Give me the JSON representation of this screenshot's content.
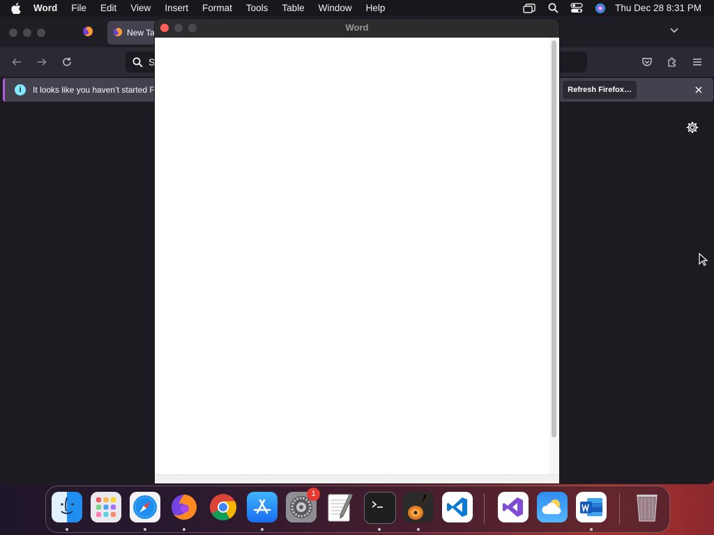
{
  "menubar": {
    "app_name": "Word",
    "menus": [
      "File",
      "Edit",
      "View",
      "Insert",
      "Format",
      "Tools",
      "Table",
      "Window",
      "Help"
    ],
    "clock": "Thu Dec 28  8:31 PM",
    "status_icons": [
      "window-switcher-icon",
      "spotlight-search-icon",
      "control-center-icon",
      "siri-icon"
    ]
  },
  "firefox": {
    "tab_title": "New Ta",
    "url_placeholder": "S",
    "notification": {
      "message": "It looks like you haven’t started Fi",
      "button_label": "Refresh Firefox…"
    }
  },
  "word": {
    "window_title": "Word"
  },
  "dock": {
    "apps": [
      {
        "name": "Finder",
        "icon": "finder-icon",
        "running": true
      },
      {
        "name": "Launchpad",
        "icon": "launchpad-icon",
        "running": false
      },
      {
        "name": "Safari",
        "icon": "safari-icon",
        "running": true
      },
      {
        "name": "Firefox",
        "icon": "firefox-icon",
        "running": true
      },
      {
        "name": "Google Chrome",
        "icon": "chrome-icon",
        "running": false
      },
      {
        "name": "App Store",
        "icon": "app-store-icon",
        "running": true
      },
      {
        "name": "System Settings",
        "icon": "system-settings-icon",
        "running": false,
        "badge": "1"
      },
      {
        "name": "TextEdit",
        "icon": "textedit-icon",
        "running": false
      },
      {
        "name": "Terminal",
        "icon": "terminal-icon",
        "running": true
      },
      {
        "name": "GarageBand",
        "icon": "garageband-icon",
        "running": true
      },
      {
        "name": "Visual Studio Code",
        "icon": "vscode-icon",
        "running": false
      },
      {
        "name": "Visual Studio",
        "icon": "visual-studio-icon",
        "running": false
      },
      {
        "name": "Weather",
        "icon": "weather-icon",
        "running": false
      },
      {
        "name": "Microsoft Word",
        "icon": "word-icon",
        "running": true
      },
      {
        "name": "Trash",
        "icon": "trash-icon",
        "running": false
      }
    ]
  },
  "colors": {
    "menubar_bg": "#17171c",
    "firefox_bg": "#1c1b22",
    "notification_accent": "#b15fe0",
    "close_red": "#ff5f57",
    "badge_red": "#e8392f"
  }
}
